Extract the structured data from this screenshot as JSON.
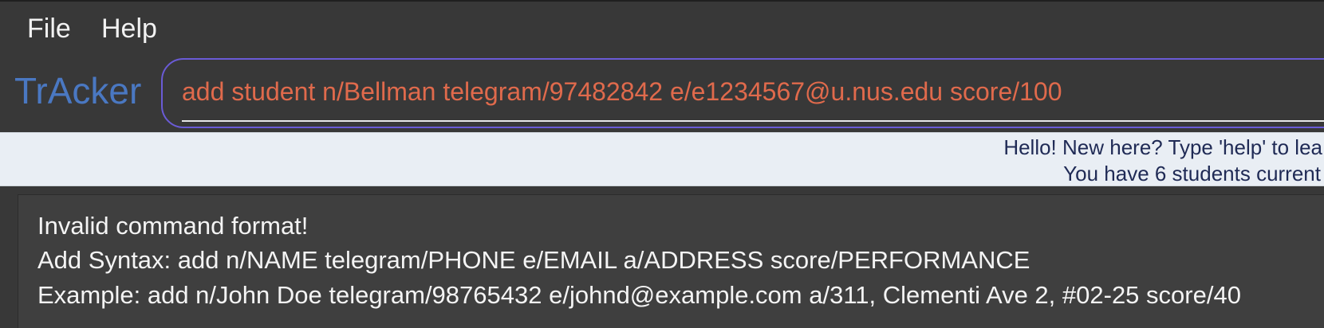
{
  "menu": {
    "file_label": "File",
    "help_label": "Help"
  },
  "app": {
    "title": "TrAcker"
  },
  "command": {
    "value": "add student n/Bellman telegram/97482842 e/e1234567@u.nus.edu score/100"
  },
  "status": {
    "line1": "Hello! New here? Type 'help' to lea",
    "line2": "You have 6 students current"
  },
  "result": {
    "line1": "Invalid command format!",
    "line2": "Add Syntax: add n/NAME telegram/PHONE e/EMAIL a/ADDRESS score/PERFORMANCE",
    "line3": "Example: add n/John Doe telegram/98765432 e/johnd@example.com a/311, Clementi Ave 2, #02-25 score/40"
  },
  "colors": {
    "background": "#383838",
    "title": "#4a78c2",
    "command_text": "#e06a4c",
    "command_border": "#6a5bd6",
    "status_background": "#e9eef4",
    "status_text": "#1f2a55"
  }
}
